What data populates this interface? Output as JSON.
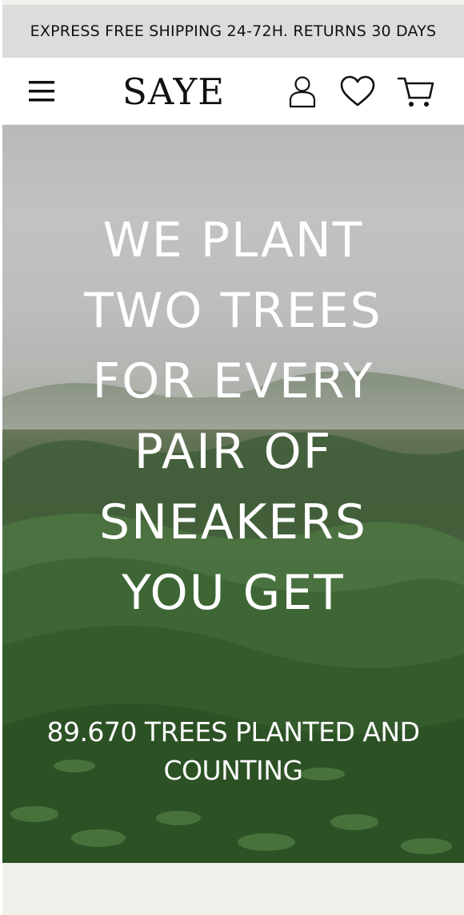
{
  "promo": {
    "text": "EXPRESS FREE SHIPPING 24-72H. RETURNS 30 DAYS"
  },
  "header": {
    "logo": "SAYE",
    "icons": {
      "menu": "hamburger-menu-icon",
      "account": "user-icon",
      "wishlist": "heart-icon",
      "cart": "shopping-cart-icon"
    }
  },
  "hero": {
    "headline_lines": [
      "WE PLANT",
      "TWO TREES",
      "FOR EVERY",
      "PAIR OF",
      "SNEAKERS",
      "YOU GET"
    ],
    "counter_lines": [
      "89.670 TREES PLANTED AND",
      "COUNTING"
    ],
    "background": "misty tea plantation hills"
  },
  "colors": {
    "promo_bg": "#dcdcdc",
    "header_bg": "#ffffff",
    "text_dark": "#111111",
    "hero_text": "#ffffff",
    "page_bg": "#f0efea"
  }
}
